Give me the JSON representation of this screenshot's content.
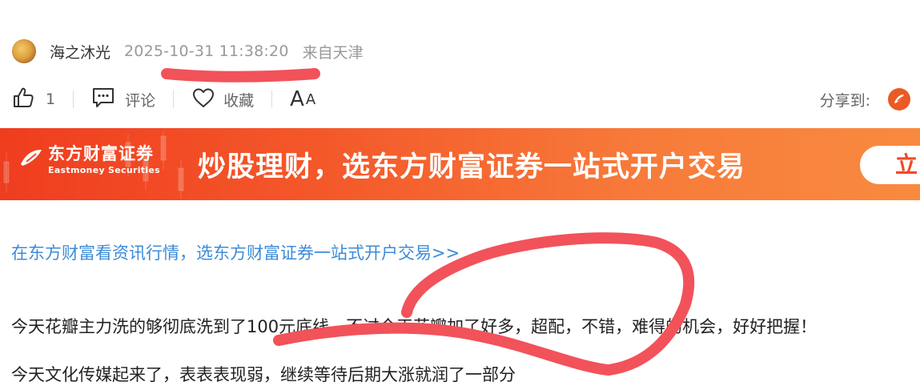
{
  "post": {
    "author": "海之沐光",
    "time": "2025-10-31 11:38:20",
    "location": "来自天津"
  },
  "actions": {
    "like_count": "1",
    "comment_label": "评论",
    "favorite_label": "收藏",
    "font_size_label_big": "A",
    "font_size_label_small": "A",
    "share_label": "分享到:"
  },
  "banner": {
    "logo_cn": "东方财富证券",
    "logo_en": "Eastmoney Securities",
    "slogan": "炒股理财，选东方财富证券一站式开户交易",
    "button_label": "立"
  },
  "content": {
    "promo_link": "在东方财富看资讯行情，选东方财富证券一站式开户交易>>",
    "paragraphs": [
      "今天花瓣主力洗的够彻底洗到了100元底线，不过今天花瓣加了好多，超配，不错，难得的机会，好好把握！",
      "今天文化传媒起来了，表表表现弱，继续等待后期大涨就润了一部分"
    ]
  },
  "colors": {
    "link": "#3d8bd8",
    "banner_start": "#ef3d1f",
    "banner_end": "#f88a3f",
    "annotation": "#f2525a",
    "share_icon": "#ea5a25"
  }
}
